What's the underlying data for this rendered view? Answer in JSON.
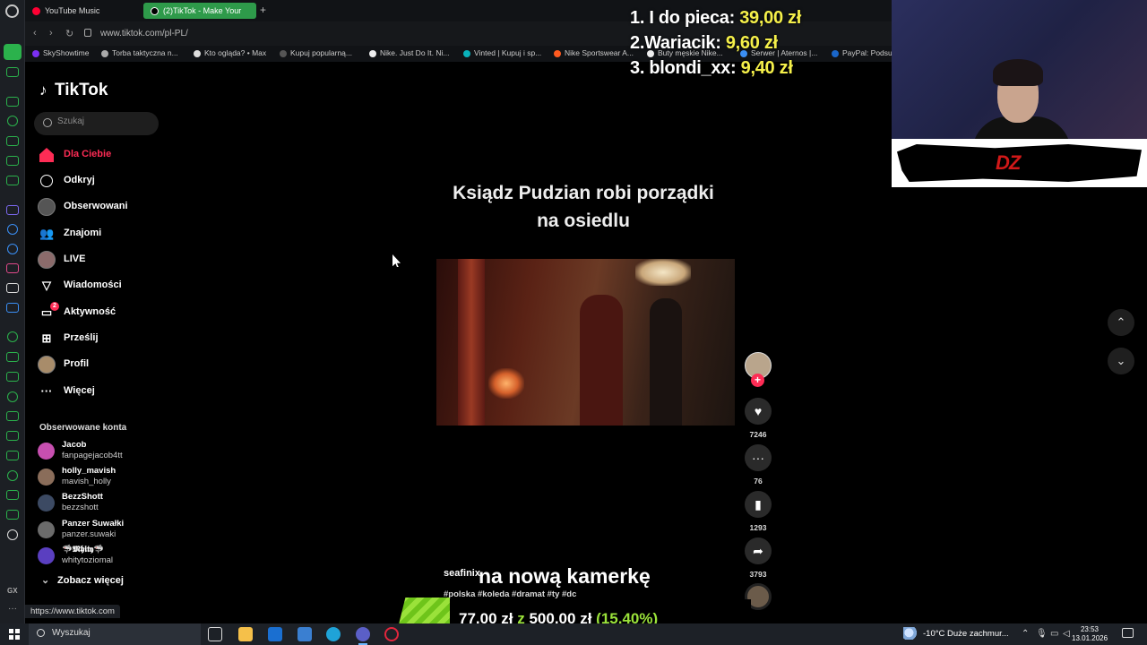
{
  "browser": {
    "tabs": [
      {
        "label": "YouTube Music"
      },
      {
        "label": "(2)TikTok - Make Your"
      }
    ],
    "url": "www.tiktok.com/pl-PL/",
    "bookmarks": [
      "SkyShowtime",
      "Torba taktyczna n...",
      "Kto ogląda? • Max",
      "Kupuj popularną...",
      "Nike. Just Do It. Ni...",
      "Vinted | Kupuj i sp...",
      "Nike Sportswear A...",
      "Buty męskie Nike...",
      "Serwer | Aternos |...",
      "PayPal: Podsum"
    ],
    "status_url": "https://www.tiktok.com",
    "gx_label": "GX",
    "new_tab": "+"
  },
  "tiktok": {
    "logo": "TikTok",
    "search_placeholder": "Szukaj",
    "nav": [
      {
        "label": "Dla Ciebie",
        "icon": "home-icon",
        "active": true
      },
      {
        "label": "Odkryj",
        "icon": "compass-icon"
      },
      {
        "label": "Obserwowani",
        "icon": "avatar-icon"
      },
      {
        "label": "Znajomi",
        "icon": "friends-icon"
      },
      {
        "label": "LIVE",
        "icon": "live-icon"
      },
      {
        "label": "Wiadomości",
        "icon": "paper-plane-icon"
      },
      {
        "label": "Aktywność",
        "icon": "activity-icon",
        "badge": "2"
      },
      {
        "label": "Prześlij",
        "icon": "upload-icon"
      },
      {
        "label": "Profil",
        "icon": "profile-avatar-icon"
      },
      {
        "label": "Więcej",
        "icon": "more-icon"
      }
    ],
    "followed_title": "Obserwowane konta",
    "followed": [
      {
        "name": "Jacob",
        "handle": "fanpagejacob4tt",
        "color": "#c74fb0"
      },
      {
        "name": "holly_mavish",
        "handle": "mavish_holly",
        "color": "#8a6d5a"
      },
      {
        "name": "BezzShott",
        "handle": "bezzshott",
        "color": "#3c4a63"
      },
      {
        "name": "Panzer Suwałki",
        "handle": "panzer.suwaki",
        "color": "#6b6b6b"
      },
      {
        "name": "🦈𝕸𝖍𝖎𝖙𝖞🦈",
        "handle": "whitytoziomal",
        "color": "#5a3fc0"
      }
    ],
    "see_more": "Zobacz więcej"
  },
  "video": {
    "title_line1": "Ksiądz Pudzian robi porządki",
    "title_line2": "na osiedlu",
    "author": "seafinix",
    "subtitle": "na nową kamerkę",
    "hashtags": "#polska #koleda #dramat #ty #dc",
    "likes": "7246",
    "comments": "76",
    "saves": "1293",
    "shares": "3793"
  },
  "overlay": {
    "leaderboard": [
      {
        "rank": "1.",
        "name": "I do pieca:",
        "amount": "39,00 zł"
      },
      {
        "rank": "2.",
        "name": "Wariacik:",
        "amount": "9,60 zł"
      },
      {
        "rank": "3.",
        "name": "blondi_xx:",
        "amount": "9,40 zł"
      }
    ],
    "banner_text": "DZ",
    "goal": {
      "current": "77,00 zł",
      "sep": "z",
      "target": "500,00 zł",
      "percent": "(15.40%)",
      "progress": 0.154
    }
  },
  "taskbar": {
    "search_placeholder": "Wyszukaj",
    "weather": "-10°C  Duże zachmur...",
    "time": "23:53",
    "date": "13.01.2026"
  },
  "colors": {
    "accent": "#fe2c55",
    "opera_green": "#2bb24c",
    "leader_amount": "#f5f04a",
    "goal_green": "#9ae23a"
  }
}
